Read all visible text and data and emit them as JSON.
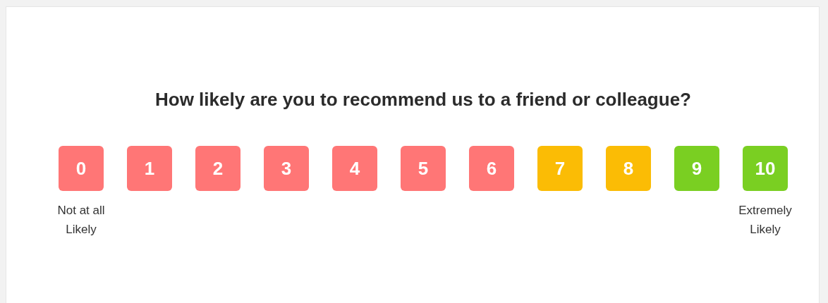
{
  "question": "How likely are you to recommend us to a friend or colleague?",
  "options": [
    {
      "label": "0",
      "color": "#ff7676",
      "caption": "Not at all Likely"
    },
    {
      "label": "1",
      "color": "#ff7676"
    },
    {
      "label": "2",
      "color": "#ff7676"
    },
    {
      "label": "3",
      "color": "#ff7676"
    },
    {
      "label": "4",
      "color": "#ff7676"
    },
    {
      "label": "5",
      "color": "#ff7676"
    },
    {
      "label": "6",
      "color": "#ff7676"
    },
    {
      "label": "7",
      "color": "#fbbc05"
    },
    {
      "label": "8",
      "color": "#fbbc05"
    },
    {
      "label": "9",
      "color": "#7acf22"
    },
    {
      "label": "10",
      "color": "#7acf22",
      "caption": "Extremely Likely"
    }
  ]
}
